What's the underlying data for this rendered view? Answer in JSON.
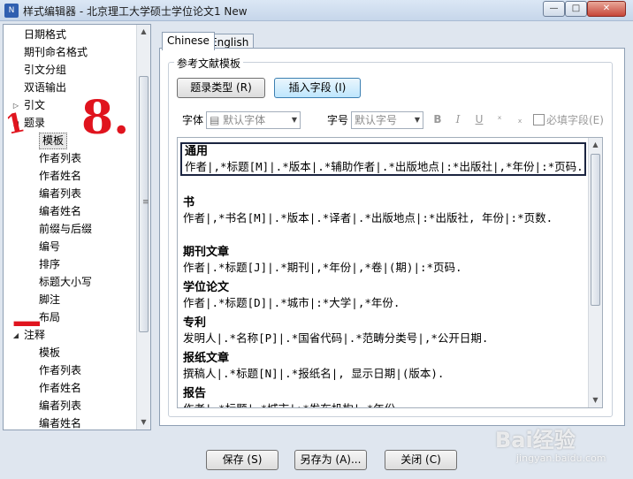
{
  "window": {
    "title": "样式编辑器 - 北京理工大学硕士学位论文1 New",
    "app_icon": "N",
    "minimize_glyph": "—",
    "maximize_glyph": "□",
    "close_glyph": "✕"
  },
  "tree": {
    "items": [
      {
        "label": "日期格式",
        "level": 1
      },
      {
        "label": "期刊命名格式",
        "level": 1
      },
      {
        "label": "引文分组",
        "level": 1
      },
      {
        "label": "双语输出",
        "level": 1
      },
      {
        "label": "引文",
        "level": 1,
        "toggle": "▷"
      },
      {
        "label": "题录",
        "level": 1,
        "toggle": "◢"
      },
      {
        "label": "模板",
        "level": 2,
        "selected": true
      },
      {
        "label": "作者列表",
        "level": 2
      },
      {
        "label": "作者姓名",
        "level": 2
      },
      {
        "label": "编者列表",
        "level": 2
      },
      {
        "label": "编者姓名",
        "level": 2
      },
      {
        "label": "前缀与后缀",
        "level": 2
      },
      {
        "label": "编号",
        "level": 2
      },
      {
        "label": "排序",
        "level": 2
      },
      {
        "label": "标题大小写",
        "level": 2
      },
      {
        "label": "脚注",
        "level": 2
      },
      {
        "label": "布局",
        "level": 2
      },
      {
        "label": "注释",
        "level": 1,
        "toggle": "◢"
      },
      {
        "label": "模板",
        "level": 2
      },
      {
        "label": "作者列表",
        "level": 2
      },
      {
        "label": "作者姓名",
        "level": 2
      },
      {
        "label": "编者列表",
        "level": 2
      },
      {
        "label": "编者姓名",
        "level": 2
      }
    ]
  },
  "annotations": {
    "number": "8.",
    "mark1": "1",
    "mark2": "-"
  },
  "tabs": [
    {
      "label": "Chinese",
      "active": true
    },
    {
      "label": "English",
      "active": false
    }
  ],
  "group": {
    "title": "参考文献模板",
    "ref_type_button": "题录类型 (R)",
    "insert_field_button": "插入字段 (I)",
    "font_label": "字体",
    "font_value": "默认字体",
    "size_label": "字号",
    "size_value": "默认字号",
    "bold": "B",
    "italic": "I",
    "underline": "U",
    "superscript": "ˣ",
    "subscript": "ₓ",
    "required_field_label": "必填字段(E)"
  },
  "templates": [
    {
      "title": "通用",
      "body": "作者|,*标题[M]|.*版本|.*辅助作者|.*出版地点|:*出版社|,*年份|:*页码.",
      "selected": true
    },
    {
      "title": "书",
      "body": "作者|,*书名[M]|.*版本|.*译者|.*出版地点|:*出版社, 年份|:*页数."
    },
    {
      "title": "期刊文章",
      "body": "作者|.*标题[J]|.*期刊|,*年份|,*卷|(期)|:*页码."
    },
    {
      "title": "学位论文",
      "body": "作者|.*标题[D]|.*城市|:*大学|,*年份."
    },
    {
      "title": "专利",
      "body": "发明人|.*名称[P]|.*国省代码|.*范畴分类号|,*公开日期."
    },
    {
      "title": "报纸文章",
      "body": "撰稿人|.*标题[N]|.*报纸名|, 显示日期|(版本)."
    },
    {
      "title": "报告",
      "body": "作者|.*标题|.*城市|:*发布机构|,*年份"
    }
  ],
  "footer": {
    "save": "保存 (S)",
    "save_as": "另存为 (A)...",
    "close": "关闭 (C)"
  },
  "watermark": {
    "text": "Bai经验",
    "url": "jingyan.baidu.com"
  }
}
